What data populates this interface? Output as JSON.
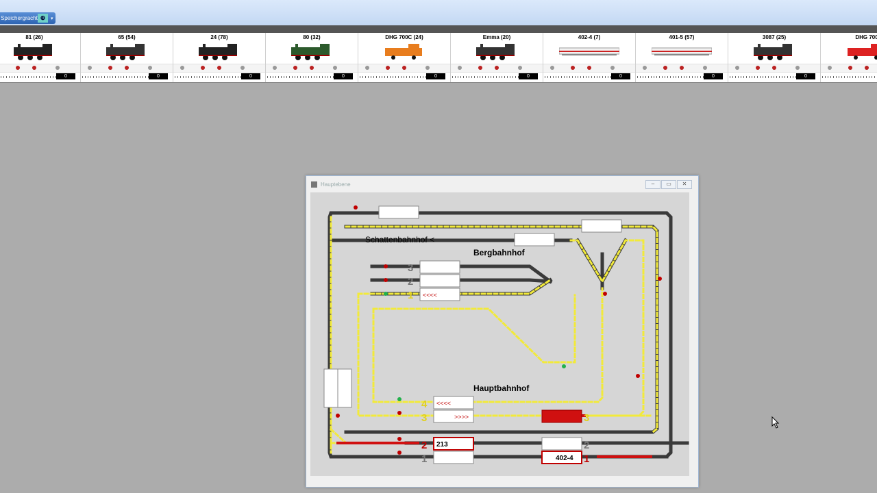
{
  "app": {
    "save_button": "Speichergracht"
  },
  "locos": [
    {
      "name": "81 (26)",
      "img": "steam",
      "color": "#222",
      "speed": "0"
    },
    {
      "name": "65 (54)",
      "img": "steam",
      "color": "#333",
      "speed": "0"
    },
    {
      "name": "24 (78)",
      "img": "steam",
      "color": "#222",
      "speed": "0"
    },
    {
      "name": "80 (32)",
      "img": "steam",
      "color": "#2c5a2c",
      "speed": "0"
    },
    {
      "name": "DHG 700C (24)",
      "img": "diesel",
      "color": "#e87d1e",
      "speed": "0"
    },
    {
      "name": "Emma (20)",
      "img": "steam",
      "color": "#333",
      "speed": "0"
    },
    {
      "name": "402-4 (7)",
      "img": "ice",
      "color": "#ddd",
      "speed": "0"
    },
    {
      "name": "401-5 (57)",
      "img": "ice",
      "color": "#ddd",
      "speed": "0"
    },
    {
      "name": "3087 (25)",
      "img": "steam",
      "color": "#333",
      "speed": "0"
    },
    {
      "name": "DHG 700",
      "img": "diesel",
      "color": "#d22",
      "speed": "0"
    }
  ],
  "window": {
    "title": "Hauptebene",
    "buttons": [
      "minimize",
      "maximize",
      "close"
    ]
  },
  "layout": {
    "labels": {
      "shadow": "Schattenbahnhof <",
      "mountain": "Bergbahnhof",
      "main": "Hauptbahnhof"
    },
    "berg_tracks": [
      "3",
      "2",
      "1"
    ],
    "berg_arrow": "<<<<",
    "haupt_tracks_left": [
      "4",
      "3",
      "2",
      "1"
    ],
    "haupt_arrows": [
      "<<<<",
      ">>>>"
    ],
    "haupt_tracks_right": [
      "3",
      "2",
      "1"
    ],
    "train_blocks": [
      "213",
      "402-4"
    ]
  },
  "colors": {
    "track_yellow": "#f2ea3a",
    "track_dark": "#3a3a3a",
    "occupied": "#d01010",
    "signal_red": "#c00000",
    "signal_green": "#22b14c"
  }
}
